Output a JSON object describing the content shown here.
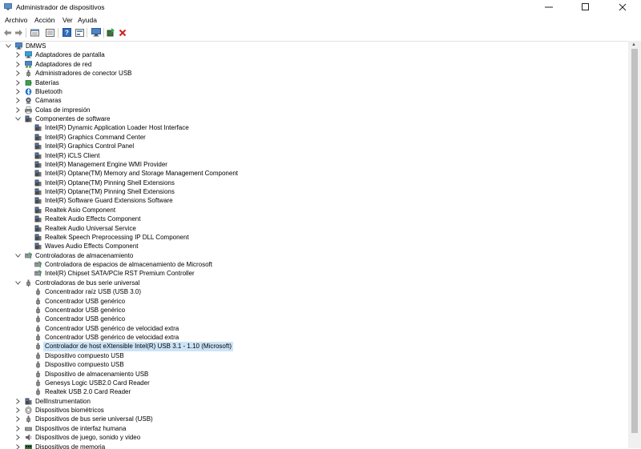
{
  "window": {
    "title": "Administrador de dispositivos"
  },
  "menu": [
    {
      "label": "Archivo"
    },
    {
      "label": "Acción"
    },
    {
      "label": "Ver"
    },
    {
      "label": "Ayuda"
    }
  ],
  "toolbar": [
    {
      "icon": "back-arrow-icon"
    },
    {
      "icon": "forward-arrow-icon"
    },
    {
      "icon": "properties-icon"
    },
    {
      "icon": "view-icon"
    },
    {
      "icon": "help-icon"
    },
    {
      "icon": "action-icon"
    },
    {
      "icon": "scan-hardware-icon"
    },
    {
      "icon": "update-driver-icon"
    },
    {
      "icon": "uninstall-icon"
    }
  ],
  "tree": [
    {
      "label": "DMWS",
      "level": 0,
      "expanded": true,
      "icon": "computer"
    },
    {
      "label": "Adaptadores de pantalla",
      "level": 1,
      "expanded": false,
      "icon": "display"
    },
    {
      "label": "Adaptadores de red",
      "level": 1,
      "expanded": false,
      "icon": "network"
    },
    {
      "label": "Administradores de conector USB",
      "level": 1,
      "expanded": false,
      "icon": "usb"
    },
    {
      "label": "Baterías",
      "level": 1,
      "expanded": false,
      "icon": "battery"
    },
    {
      "label": "Bluetooth",
      "level": 1,
      "expanded": false,
      "icon": "bluetooth"
    },
    {
      "label": "Cámaras",
      "level": 1,
      "expanded": false,
      "icon": "camera"
    },
    {
      "label": "Colas de impresión",
      "level": 1,
      "expanded": false,
      "icon": "printer"
    },
    {
      "label": "Componentes de software",
      "level": 1,
      "expanded": true,
      "icon": "software"
    },
    {
      "label": "Intel(R) Dynamic Application Loader Host Interface",
      "level": 2,
      "icon": "software"
    },
    {
      "label": "Intel(R) Graphics Command Center",
      "level": 2,
      "icon": "software"
    },
    {
      "label": "Intel(R) Graphics Control Panel",
      "level": 2,
      "icon": "software"
    },
    {
      "label": "Intel(R) iCLS Client",
      "level": 2,
      "icon": "software"
    },
    {
      "label": "Intel(R) Management Engine WMI Provider",
      "level": 2,
      "icon": "software"
    },
    {
      "label": "Intel(R) Optane(TM) Memory and Storage Management Component",
      "level": 2,
      "icon": "software"
    },
    {
      "label": "Intel(R) Optane(TM) Pinning Shell Extensions",
      "level": 2,
      "icon": "software"
    },
    {
      "label": "Intel(R) Optane(TM) Pinning Shell Extensions",
      "level": 2,
      "icon": "software"
    },
    {
      "label": "Intel(R) Software Guard Extensions Software",
      "level": 2,
      "icon": "software"
    },
    {
      "label": "Realtek Asio Component",
      "level": 2,
      "icon": "software"
    },
    {
      "label": "Realtek Audio Effects Component",
      "level": 2,
      "icon": "software"
    },
    {
      "label": "Realtek Audio Universal Service",
      "level": 2,
      "icon": "software"
    },
    {
      "label": "Realtek Speech Preprocessing IP DLL Component",
      "level": 2,
      "icon": "software"
    },
    {
      "label": "Waves Audio Effects Component",
      "level": 2,
      "icon": "software"
    },
    {
      "label": "Controladoras de almacenamiento",
      "level": 1,
      "expanded": true,
      "icon": "storage"
    },
    {
      "label": "Controladora de espacios de almacenamiento de Microsoft",
      "level": 2,
      "icon": "storage"
    },
    {
      "label": "Intel(R) Chipset SATA/PCIe RST Premium Controller",
      "level": 2,
      "icon": "storage"
    },
    {
      "label": "Controladoras de bus serie universal",
      "level": 1,
      "expanded": true,
      "icon": "usb"
    },
    {
      "label": "Concentrador raíz USB (USB 3.0)",
      "level": 2,
      "icon": "usb"
    },
    {
      "label": "Concentrador USB genérico",
      "level": 2,
      "icon": "usb"
    },
    {
      "label": "Concentrador USB genérico",
      "level": 2,
      "icon": "usb"
    },
    {
      "label": "Concentrador USB genérico",
      "level": 2,
      "icon": "usb"
    },
    {
      "label": "Concentrador USB genérico de velocidad extra",
      "level": 2,
      "icon": "usb"
    },
    {
      "label": "Concentrador USB genérico de velocidad extra",
      "level": 2,
      "icon": "usb"
    },
    {
      "label": "Controlador de host eXtensible Intel(R) USB 3.1 - 1.10 (Microsoft)",
      "level": 2,
      "icon": "usb",
      "selected": true
    },
    {
      "label": "Dispositivo compuesto USB",
      "level": 2,
      "icon": "usb"
    },
    {
      "label": "Dispositivo compuesto USB",
      "level": 2,
      "icon": "usb"
    },
    {
      "label": "Dispositivo de almacenamiento USB",
      "level": 2,
      "icon": "usb"
    },
    {
      "label": "Genesys Logic USB2.0 Card Reader",
      "level": 2,
      "icon": "usb"
    },
    {
      "label": "Realtek USB 2.0 Card Reader",
      "level": 2,
      "icon": "usb"
    },
    {
      "label": "DellInstrumentation",
      "level": 1,
      "expanded": false,
      "icon": "software"
    },
    {
      "label": "Dispositivos biométricos",
      "level": 1,
      "expanded": false,
      "icon": "biometric"
    },
    {
      "label": "Dispositivos de bus serie universal (USB)",
      "level": 1,
      "expanded": false,
      "icon": "usb"
    },
    {
      "label": "Dispositivos de interfaz humana",
      "level": 1,
      "expanded": false,
      "icon": "hid"
    },
    {
      "label": "Dispositivos de juego, sonido y video",
      "level": 1,
      "expanded": false,
      "icon": "sound"
    },
    {
      "label": "Dispositivos de memoria",
      "level": 1,
      "expanded": false,
      "icon": "memory"
    }
  ]
}
